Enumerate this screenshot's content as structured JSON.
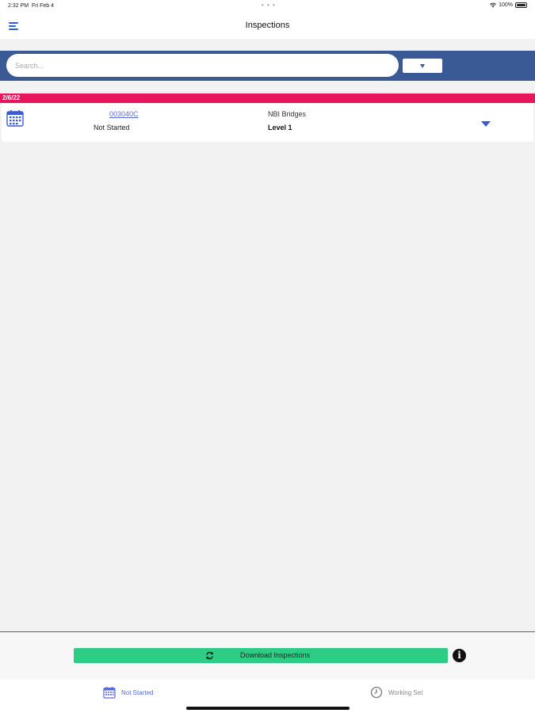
{
  "status_bar": {
    "time": "2:32 PM",
    "date": "Fri Feb 4",
    "dots": "• • •",
    "battery": "100%"
  },
  "nav": {
    "title": "Inspections",
    "menu_icon": "hamburger-menu-icon"
  },
  "search": {
    "placeholder": "Search...",
    "value": "",
    "filter_icon": "filter-triangle-icon"
  },
  "groups": [
    {
      "date": "2/6/22",
      "inspections": [
        {
          "id": "003040C",
          "status": "Not Started",
          "asset_type": "NBI Bridges",
          "level": "Level 1",
          "icon": "calendar-icon"
        }
      ]
    }
  ],
  "footer": {
    "download_label": "Download Inspections",
    "download_icon": "refresh-icon",
    "info_icon": "info-icon"
  },
  "tabs": [
    {
      "label": "Not Started",
      "icon": "calendar-icon",
      "active": true
    },
    {
      "label": "Working Set",
      "icon": "clock-icon",
      "active": false
    }
  ],
  "colors": {
    "accent": "#3a5a96",
    "date_header": "#e8175d",
    "download_button": "#2ecc84",
    "link": "#5a6ad6"
  }
}
